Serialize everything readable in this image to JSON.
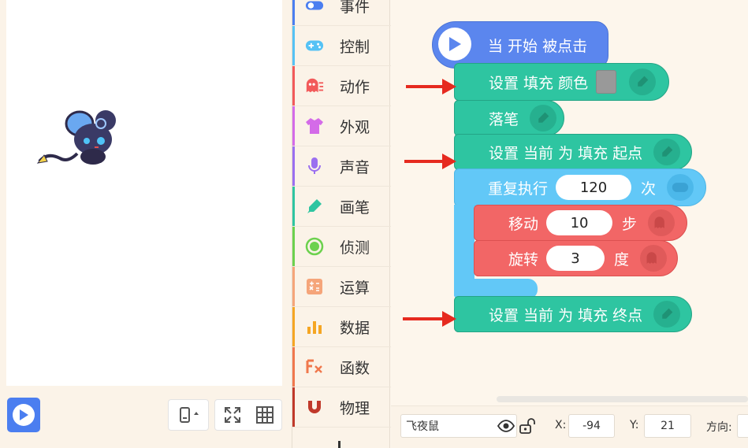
{
  "stage": {
    "sprite_icon": "mouse-sprite",
    "run_icon": "play-icon"
  },
  "toolbar": {
    "device_icon": "phone-rotate-icon",
    "fullscreen_icon": "fullscreen-icon",
    "grid_icon": "grid-icon"
  },
  "categories": [
    {
      "label": "事件",
      "color": "#4b7ef0",
      "icon": "toggle-icon"
    },
    {
      "label": "控制",
      "color": "#55c2f5",
      "icon": "gamepad-icon"
    },
    {
      "label": "动作",
      "color": "#f25a5a",
      "icon": "ghost-icon"
    },
    {
      "label": "外观",
      "color": "#d46be8",
      "icon": "shirt-icon"
    },
    {
      "label": "声音",
      "color": "#9b6ff0",
      "icon": "microphone-icon"
    },
    {
      "label": "画笔",
      "color": "#2ec5a1",
      "icon": "pen-icon"
    },
    {
      "label": "侦测",
      "color": "#6cd14e",
      "icon": "target-icon"
    },
    {
      "label": "运算",
      "color": "#f5a57a",
      "icon": "calculator-icon"
    },
    {
      "label": "数据",
      "color": "#f5a623",
      "icon": "bar-chart-icon"
    },
    {
      "label": "函数",
      "color": "#f0784d",
      "icon": "function-icon"
    },
    {
      "label": "物理",
      "color": "#c0392b",
      "icon": "magnet-icon"
    }
  ],
  "blocks": {
    "hat": "当 开始 被点击",
    "set_fill_color": "设置 填充 颜色",
    "pen_down": "落笔",
    "set_fill_start": "设置 当前 为 填充 起点",
    "repeat_label": "重复执行",
    "repeat_count": "120",
    "repeat_unit": "次",
    "move_label": "移动",
    "move_value": "10",
    "move_unit": "步",
    "turn_label": "旋转",
    "turn_value": "3",
    "turn_unit": "度",
    "set_fill_end": "设置 当前 为 填充 终点"
  },
  "sprite_info": {
    "name": "飞夜鼠",
    "x_label": "X:",
    "x_value": "-94",
    "y_label": "Y:",
    "y_value": "21",
    "direction_label": "方向:"
  },
  "colors": {
    "event_blue": "#5b86ee",
    "pen_green": "#2ec5a1",
    "control_blue": "#62c8f7",
    "motion_red": "#f26666",
    "arrow_red": "#e62a1f"
  }
}
